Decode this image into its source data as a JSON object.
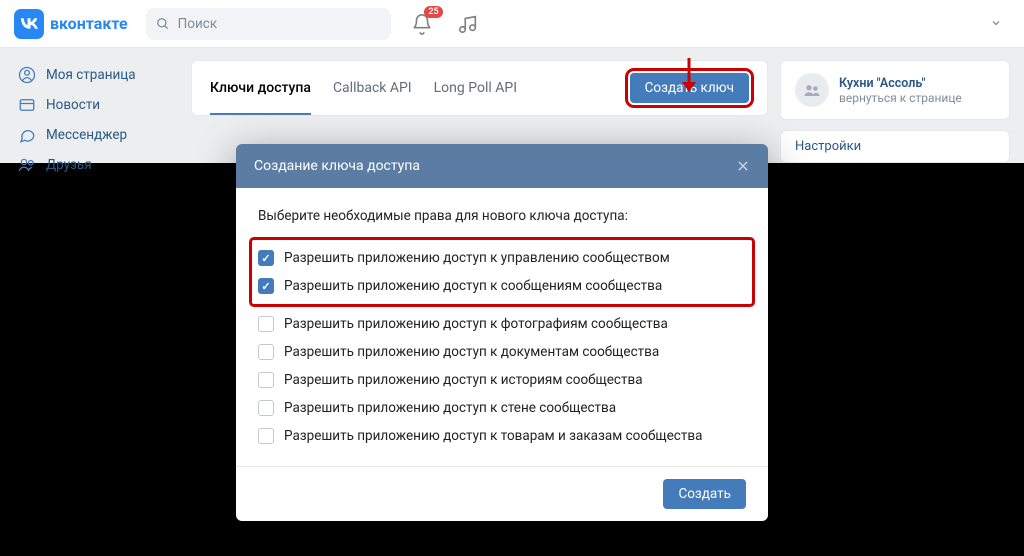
{
  "brand": "вконтакте",
  "search": {
    "placeholder": "Поиск"
  },
  "notifications": {
    "count": "25"
  },
  "sidebar": {
    "items": [
      {
        "label": "Моя страница"
      },
      {
        "label": "Новости"
      },
      {
        "label": "Мессенджер"
      },
      {
        "label": "Друзья"
      }
    ]
  },
  "tabs": {
    "items": [
      {
        "label": "Ключи доступа"
      },
      {
        "label": "Callback API"
      },
      {
        "label": "Long Poll API"
      }
    ],
    "create_button": "Создать ключ"
  },
  "community": {
    "name": "Кухни \"Ассоль\"",
    "back_label": "вернуться к странице",
    "settings_label": "Настройки"
  },
  "modal": {
    "title": "Создание ключа доступа",
    "lead": "Выберите необходимые права для нового ключа доступа:",
    "perms": [
      {
        "label": "Разрешить приложению доступ к управлению сообществом",
        "checked": true
      },
      {
        "label": "Разрешить приложению доступ к сообщениям сообщества",
        "checked": true
      },
      {
        "label": "Разрешить приложению доступ к фотографиям сообщества",
        "checked": false
      },
      {
        "label": "Разрешить приложению доступ к документам сообщества",
        "checked": false
      },
      {
        "label": "Разрешить приложению доступ к историям сообщества",
        "checked": false
      },
      {
        "label": "Разрешить приложению доступ к стене сообщества",
        "checked": false
      },
      {
        "label": "Разрешить приложению доступ к товарам и заказам сообщества",
        "checked": false
      }
    ],
    "create_button": "Создать"
  }
}
